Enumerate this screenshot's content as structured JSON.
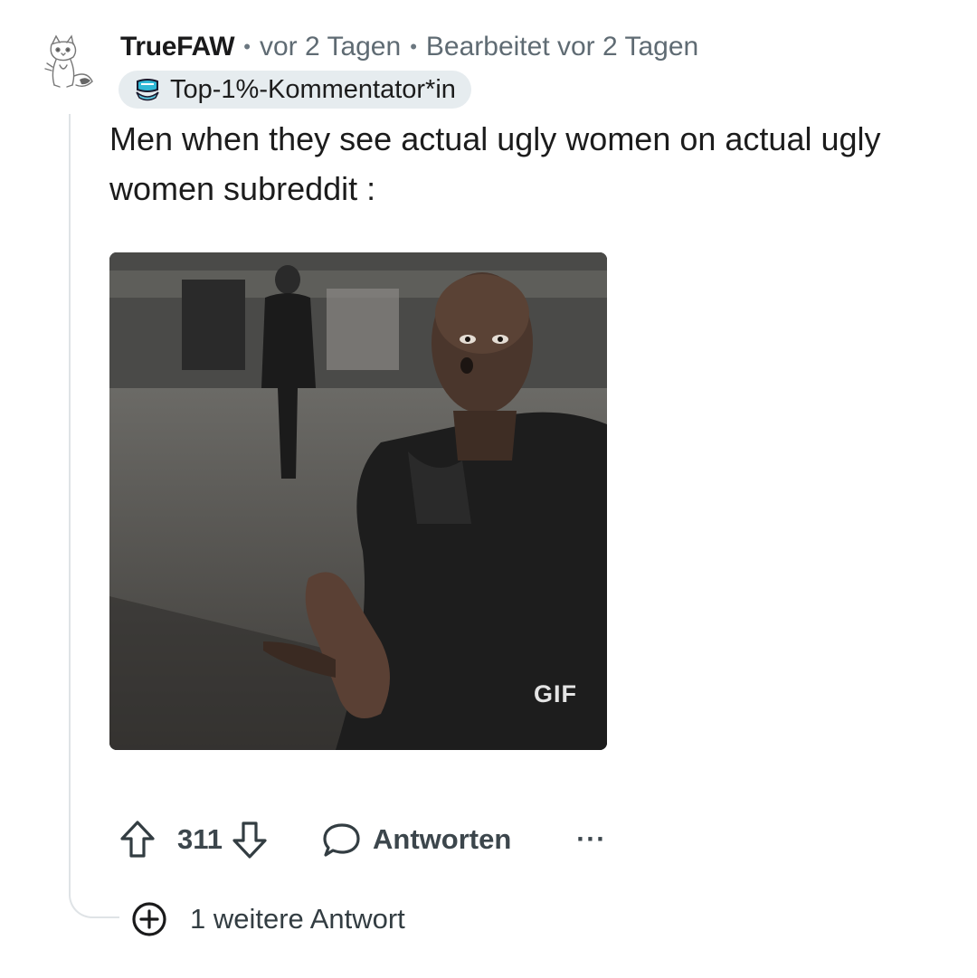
{
  "comment": {
    "username": "TrueFAW",
    "separator": "•",
    "posted": "vor 2 Tagen",
    "edited": "Bearbeitet vor 2 Tagen",
    "flair": "Top-1%-Kommentator*in",
    "body": "Men when they see actual ugly women on actual ugly women subreddit :",
    "media": {
      "badge": "GIF"
    }
  },
  "actions": {
    "upvote_icon": "arrow-up-outline-icon",
    "score": "311",
    "downvote_icon": "arrow-down-outline-icon",
    "reply_label": "Antworten",
    "more_label": "···"
  },
  "more_replies": {
    "label": "1 weitere Antwort"
  },
  "colors": {
    "text": "#1c1c1c",
    "meta": "#5f6b73",
    "flair_bg": "#e6ecef",
    "thread_line": "#dfe3e6"
  }
}
